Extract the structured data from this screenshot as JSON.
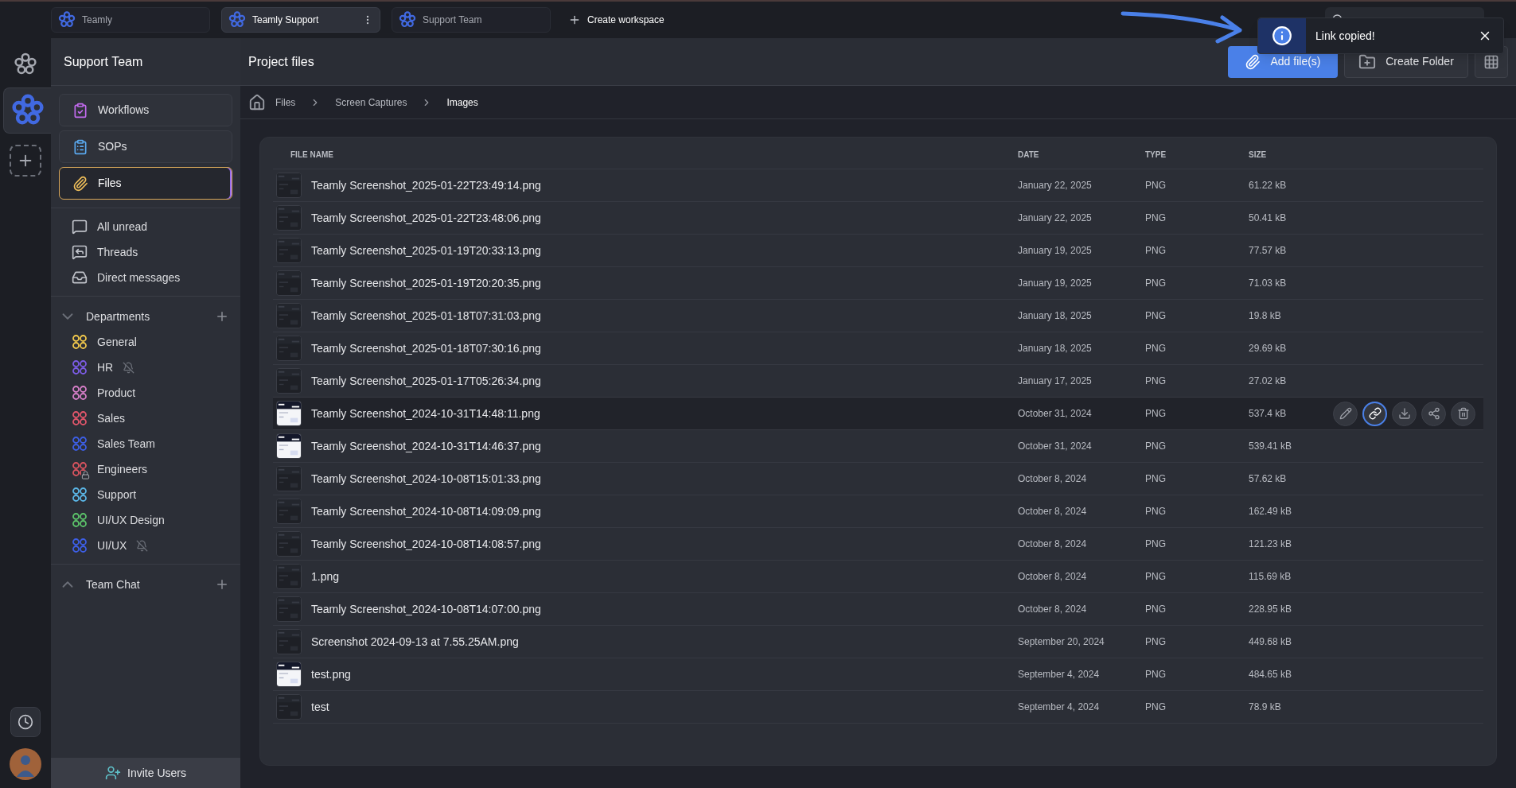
{
  "workspaces": [
    {
      "name": "Teamly",
      "selected": false
    },
    {
      "name": "Teamly Support",
      "selected": true
    },
    {
      "name": "Support Team",
      "selected": false
    }
  ],
  "create_workspace": "Create workspace",
  "toast": {
    "message": "Link copied!"
  },
  "sidebar": {
    "title": "Support Team",
    "nav": [
      {
        "label": "Workflows",
        "kind": "workflows",
        "selected": false
      },
      {
        "label": "SOPs",
        "kind": "sops",
        "selected": false
      },
      {
        "label": "Files",
        "kind": "files",
        "selected": true
      }
    ],
    "inbox": [
      {
        "label": "All unread",
        "kind": "unread"
      },
      {
        "label": "Threads",
        "kind": "threads"
      },
      {
        "label": "Direct messages",
        "kind": "direct"
      }
    ],
    "departments": {
      "title": "Departments",
      "expanded": true,
      "items": [
        {
          "name": "General",
          "color": "#f2c94c",
          "muted": false,
          "locked": false
        },
        {
          "name": "HR",
          "color": "#7c5ce6",
          "muted": true,
          "locked": false
        },
        {
          "name": "Product",
          "color": "#d77fc9",
          "muted": false,
          "locked": false
        },
        {
          "name": "Sales",
          "color": "#e2566b",
          "muted": false,
          "locked": false
        },
        {
          "name": "Sales Team",
          "color": "#3d5fe6",
          "muted": false,
          "locked": false
        },
        {
          "name": "Engineers",
          "color": "#d9545f",
          "muted": false,
          "locked": true
        },
        {
          "name": "Support",
          "color": "#5bb6e6",
          "muted": false,
          "locked": false
        },
        {
          "name": "UI/UX Design",
          "color": "#5cc46a",
          "muted": false,
          "locked": false
        },
        {
          "name": "UI/UX",
          "color": "#3d5fe6",
          "muted": true,
          "locked": false
        }
      ]
    },
    "team_chat": {
      "title": "Team Chat",
      "expanded": false
    },
    "invite": "Invite Users"
  },
  "page": {
    "title": "Project files",
    "add_button": "Add file(s)",
    "folder_button": "Create Folder",
    "breadcrumb": [
      "Files",
      "Screen Captures",
      "Images"
    ]
  },
  "table": {
    "columns": [
      "FILE NAME",
      "DATE",
      "TYPE",
      "SIZE"
    ],
    "actions": [
      {
        "kind": "edit",
        "active": false
      },
      {
        "kind": "link",
        "active": true
      },
      {
        "kind": "download",
        "active": false
      },
      {
        "kind": "share",
        "active": false
      },
      {
        "kind": "delete",
        "active": false
      }
    ],
    "rows": [
      {
        "name": "Teamly Screenshot_2025-01-22T23:49:14.png",
        "date": "January 22, 2025",
        "type": "PNG",
        "size": "61.22 kB",
        "selected": false
      },
      {
        "name": "Teamly Screenshot_2025-01-22T23:48:06.png",
        "date": "January 22, 2025",
        "type": "PNG",
        "size": "50.41 kB",
        "selected": false
      },
      {
        "name": "Teamly Screenshot_2025-01-19T20:33:13.png",
        "date": "January 19, 2025",
        "type": "PNG",
        "size": "77.57 kB",
        "selected": false
      },
      {
        "name": "Teamly Screenshot_2025-01-19T20:20:35.png",
        "date": "January 19, 2025",
        "type": "PNG",
        "size": "71.03 kB",
        "selected": false
      },
      {
        "name": "Teamly Screenshot_2025-01-18T07:31:03.png",
        "date": "January 18, 2025",
        "type": "PNG",
        "size": "19.8 kB",
        "selected": false
      },
      {
        "name": "Teamly Screenshot_2025-01-18T07:30:16.png",
        "date": "January 18, 2025",
        "type": "PNG",
        "size": "29.69 kB",
        "selected": false
      },
      {
        "name": "Teamly Screenshot_2025-01-17T05:26:34.png",
        "date": "January 17, 2025",
        "type": "PNG",
        "size": "27.02 kB",
        "selected": false
      },
      {
        "name": "Teamly Screenshot_2024-10-31T14:48:11.png",
        "date": "October 31, 2024",
        "type": "PNG",
        "size": "537.4 kB",
        "selected": true
      },
      {
        "name": "Teamly Screenshot_2024-10-31T14:46:37.png",
        "date": "October 31, 2024",
        "type": "PNG",
        "size": "539.41 kB",
        "selected": false
      },
      {
        "name": "Teamly Screenshot_2024-10-08T15:01:33.png",
        "date": "October 8, 2024",
        "type": "PNG",
        "size": "57.62 kB",
        "selected": false
      },
      {
        "name": "Teamly Screenshot_2024-10-08T14:09:09.png",
        "date": "October 8, 2024",
        "type": "PNG",
        "size": "162.49 kB",
        "selected": false
      },
      {
        "name": "Teamly Screenshot_2024-10-08T14:08:57.png",
        "date": "October 8, 2024",
        "type": "PNG",
        "size": "121.23 kB",
        "selected": false
      },
      {
        "name": "1.png",
        "date": "October 8, 2024",
        "type": "PNG",
        "size": "115.69 kB",
        "selected": false
      },
      {
        "name": "Teamly Screenshot_2024-10-08T14:07:00.png",
        "date": "October 8, 2024",
        "type": "PNG",
        "size": "228.95 kB",
        "selected": false
      },
      {
        "name": "Screenshot 2024-09-13 at 7.55.25AM.png",
        "date": "September 20, 2024",
        "type": "PNG",
        "size": "449.68 kB",
        "selected": false
      },
      {
        "name": "test.png",
        "date": "September 4, 2024",
        "type": "PNG",
        "size": "484.65 kB",
        "selected": false
      },
      {
        "name": "test",
        "date": "September 4, 2024",
        "type": "PNG",
        "size": "78.9 kB",
        "selected": false
      }
    ]
  }
}
